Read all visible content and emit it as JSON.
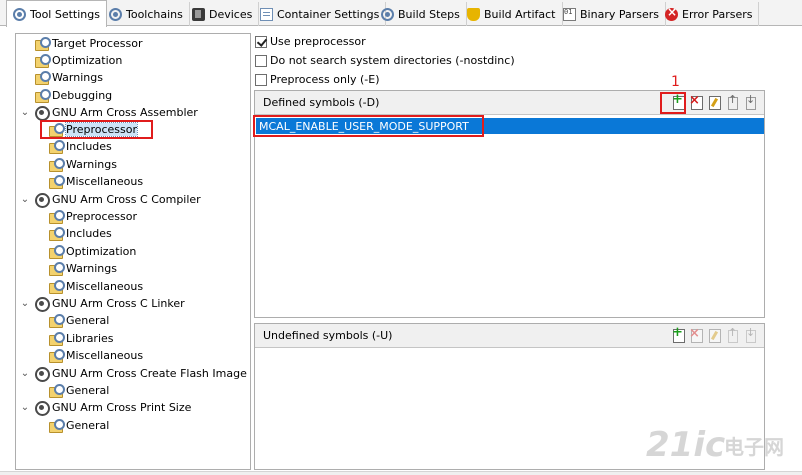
{
  "tabs": [
    {
      "label": "Tool Settings",
      "icon": "gear-icon",
      "active": true
    },
    {
      "label": "Toolchains",
      "icon": "gear-icon"
    },
    {
      "label": "Devices",
      "icon": "device-icon"
    },
    {
      "label": "Container Settings",
      "icon": "document-icon"
    },
    {
      "label": "Build Steps",
      "icon": "gear-icon"
    },
    {
      "label": "Build Artifact",
      "icon": "trophy-icon"
    },
    {
      "label": "Binary Parsers",
      "icon": "binary-icon"
    },
    {
      "label": "Error Parsers",
      "icon": "error-icon"
    }
  ],
  "tree": [
    {
      "label": "Target Processor",
      "level": 1
    },
    {
      "label": "Optimization",
      "level": 1
    },
    {
      "label": "Warnings",
      "level": 1
    },
    {
      "label": "Debugging",
      "level": 1
    },
    {
      "label": "GNU Arm Cross Assembler",
      "level": 0,
      "expanded": true
    },
    {
      "label": "Preprocessor",
      "level": 2,
      "selected": true
    },
    {
      "label": "Includes",
      "level": 2
    },
    {
      "label": "Warnings",
      "level": 2
    },
    {
      "label": "Miscellaneous",
      "level": 2
    },
    {
      "label": "GNU Arm Cross C Compiler",
      "level": 0,
      "expanded": true
    },
    {
      "label": "Preprocessor",
      "level": 2
    },
    {
      "label": "Includes",
      "level": 2
    },
    {
      "label": "Optimization",
      "level": 2
    },
    {
      "label": "Warnings",
      "level": 2
    },
    {
      "label": "Miscellaneous",
      "level": 2
    },
    {
      "label": "GNU Arm Cross C Linker",
      "level": 0,
      "expanded": true
    },
    {
      "label": "General",
      "level": 2
    },
    {
      "label": "Libraries",
      "level": 2
    },
    {
      "label": "Miscellaneous",
      "level": 2
    },
    {
      "label": "GNU Arm Cross Create Flash Image",
      "level": 0,
      "expanded": true
    },
    {
      "label": "General",
      "level": 2
    },
    {
      "label": "GNU Arm Cross Print Size",
      "level": 0,
      "expanded": true
    },
    {
      "label": "General",
      "level": 2
    }
  ],
  "options": {
    "use_preprocessor": {
      "label": "Use preprocessor",
      "checked": true
    },
    "nostdinc": {
      "label": "Do not search system directories (-nostdinc)",
      "checked": false
    },
    "preprocess_only": {
      "label": "Preprocess only (-E)",
      "checked": false
    }
  },
  "defined": {
    "title": "Defined symbols (-D)",
    "items": [
      "MCAL_ENABLE_USER_MODE_SUPPORT"
    ],
    "annotation": "1"
  },
  "undefined": {
    "title": "Undefined symbols (-U)",
    "items": []
  },
  "watermark": {
    "text_a": "21ic",
    "text_b": "电子网"
  },
  "colors": {
    "selection": "#0a78d7",
    "annotation": "#e01c1c"
  }
}
